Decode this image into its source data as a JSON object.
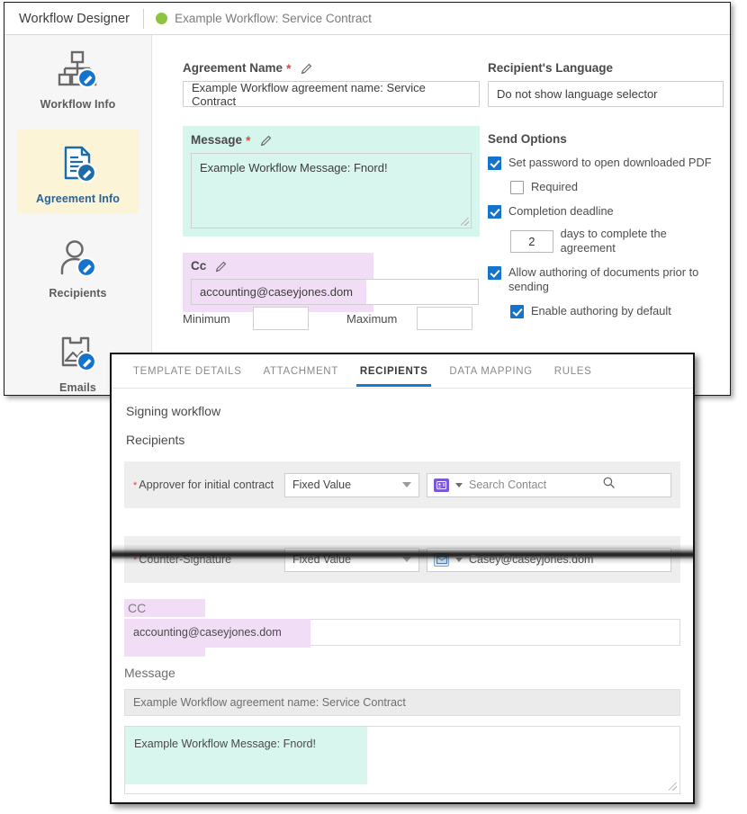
{
  "header": {
    "app_title": "Workflow Designer",
    "workflow_name": "Example Workflow: Service Contract",
    "status_dot_color": "#8cc63e"
  },
  "sidebar": {
    "items": [
      {
        "label": "Workflow Info",
        "icon": "workflow-tree-edit-icon",
        "active": false
      },
      {
        "label": "Agreement Info",
        "icon": "document-edit-icon",
        "active": true
      },
      {
        "label": "Recipients",
        "icon": "person-edit-icon",
        "active": false
      },
      {
        "label": "Emails",
        "icon": "email-image-edit-icon",
        "active": false
      }
    ],
    "active_highlight_color": "#fbf4d6",
    "active_label_color": "#2a6496"
  },
  "agreement_form": {
    "agreement_name": {
      "label": "Agreement Name",
      "required_marker": "*",
      "value": "Example Workflow agreement name: Service Contract"
    },
    "message": {
      "label": "Message",
      "required_marker": "*",
      "value": "Example Workflow Message: Fnord!",
      "highlight_color": "#d6f5ec"
    },
    "cc": {
      "label": "Cc",
      "value": "accounting@caseyjones.dom",
      "highlight_color": "#f2ddf7"
    },
    "minimum": {
      "label": "Minimum",
      "value": ""
    },
    "maximum": {
      "label": "Maximum",
      "value": ""
    }
  },
  "right_column": {
    "language": {
      "label": "Recipient's Language",
      "value": "Do not show language selector"
    },
    "send_options": {
      "title": "Send Options",
      "options": [
        {
          "label": "Set password to open downloaded PDF",
          "checked": true,
          "indent": false
        },
        {
          "label": "Required",
          "checked": false,
          "indent": true
        },
        {
          "label": "Completion deadline",
          "checked": true,
          "indent": false
        }
      ],
      "deadline": {
        "days_value": "2",
        "suffix": "days to complete the agreement"
      },
      "options2": [
        {
          "label": "Allow authoring of documents prior to sending",
          "checked": true,
          "indent": false
        },
        {
          "label": "Enable authoring by default",
          "checked": true,
          "indent": true
        }
      ],
      "checkbox_color": "#1473cc"
    }
  },
  "template_panel": {
    "tabs": [
      {
        "label": "TEMPLATE DETAILS",
        "active": false
      },
      {
        "label": "ATTACHMENT",
        "active": false
      },
      {
        "label": "RECIPIENTS",
        "active": true
      },
      {
        "label": "DATA MAPPING",
        "active": false
      },
      {
        "label": "RULES",
        "active": false
      }
    ],
    "active_tab_underline_color": "#1779d6",
    "signing_workflow_title": "Signing workflow",
    "recipients_title": "Recipients",
    "recipient_rows": [
      {
        "required_marker": "*",
        "label": "Approver for initial contract",
        "value_type": "Fixed Value",
        "channel_icon": "contact-card-icon",
        "contact_value": "",
        "contact_placeholder": "Search Contact",
        "has_search_icon": true
      },
      {
        "required_marker": "*",
        "label": "Counter-Signature",
        "value_type": "Fixed Value",
        "channel_icon": "envelope-icon",
        "contact_value": "Casey@caseyjones.dom",
        "contact_placeholder": "",
        "has_search_icon": false
      }
    ],
    "cc": {
      "label": "CC",
      "value": "accounting@caseyjones.dom",
      "highlight_color": "#f2ddf7"
    },
    "message": {
      "label": "Message",
      "name_value": "Example Workflow agreement name: Service Contract",
      "body_value": "Example Workflow Message: Fnord!",
      "highlight_color": "#d8f6ee"
    }
  }
}
